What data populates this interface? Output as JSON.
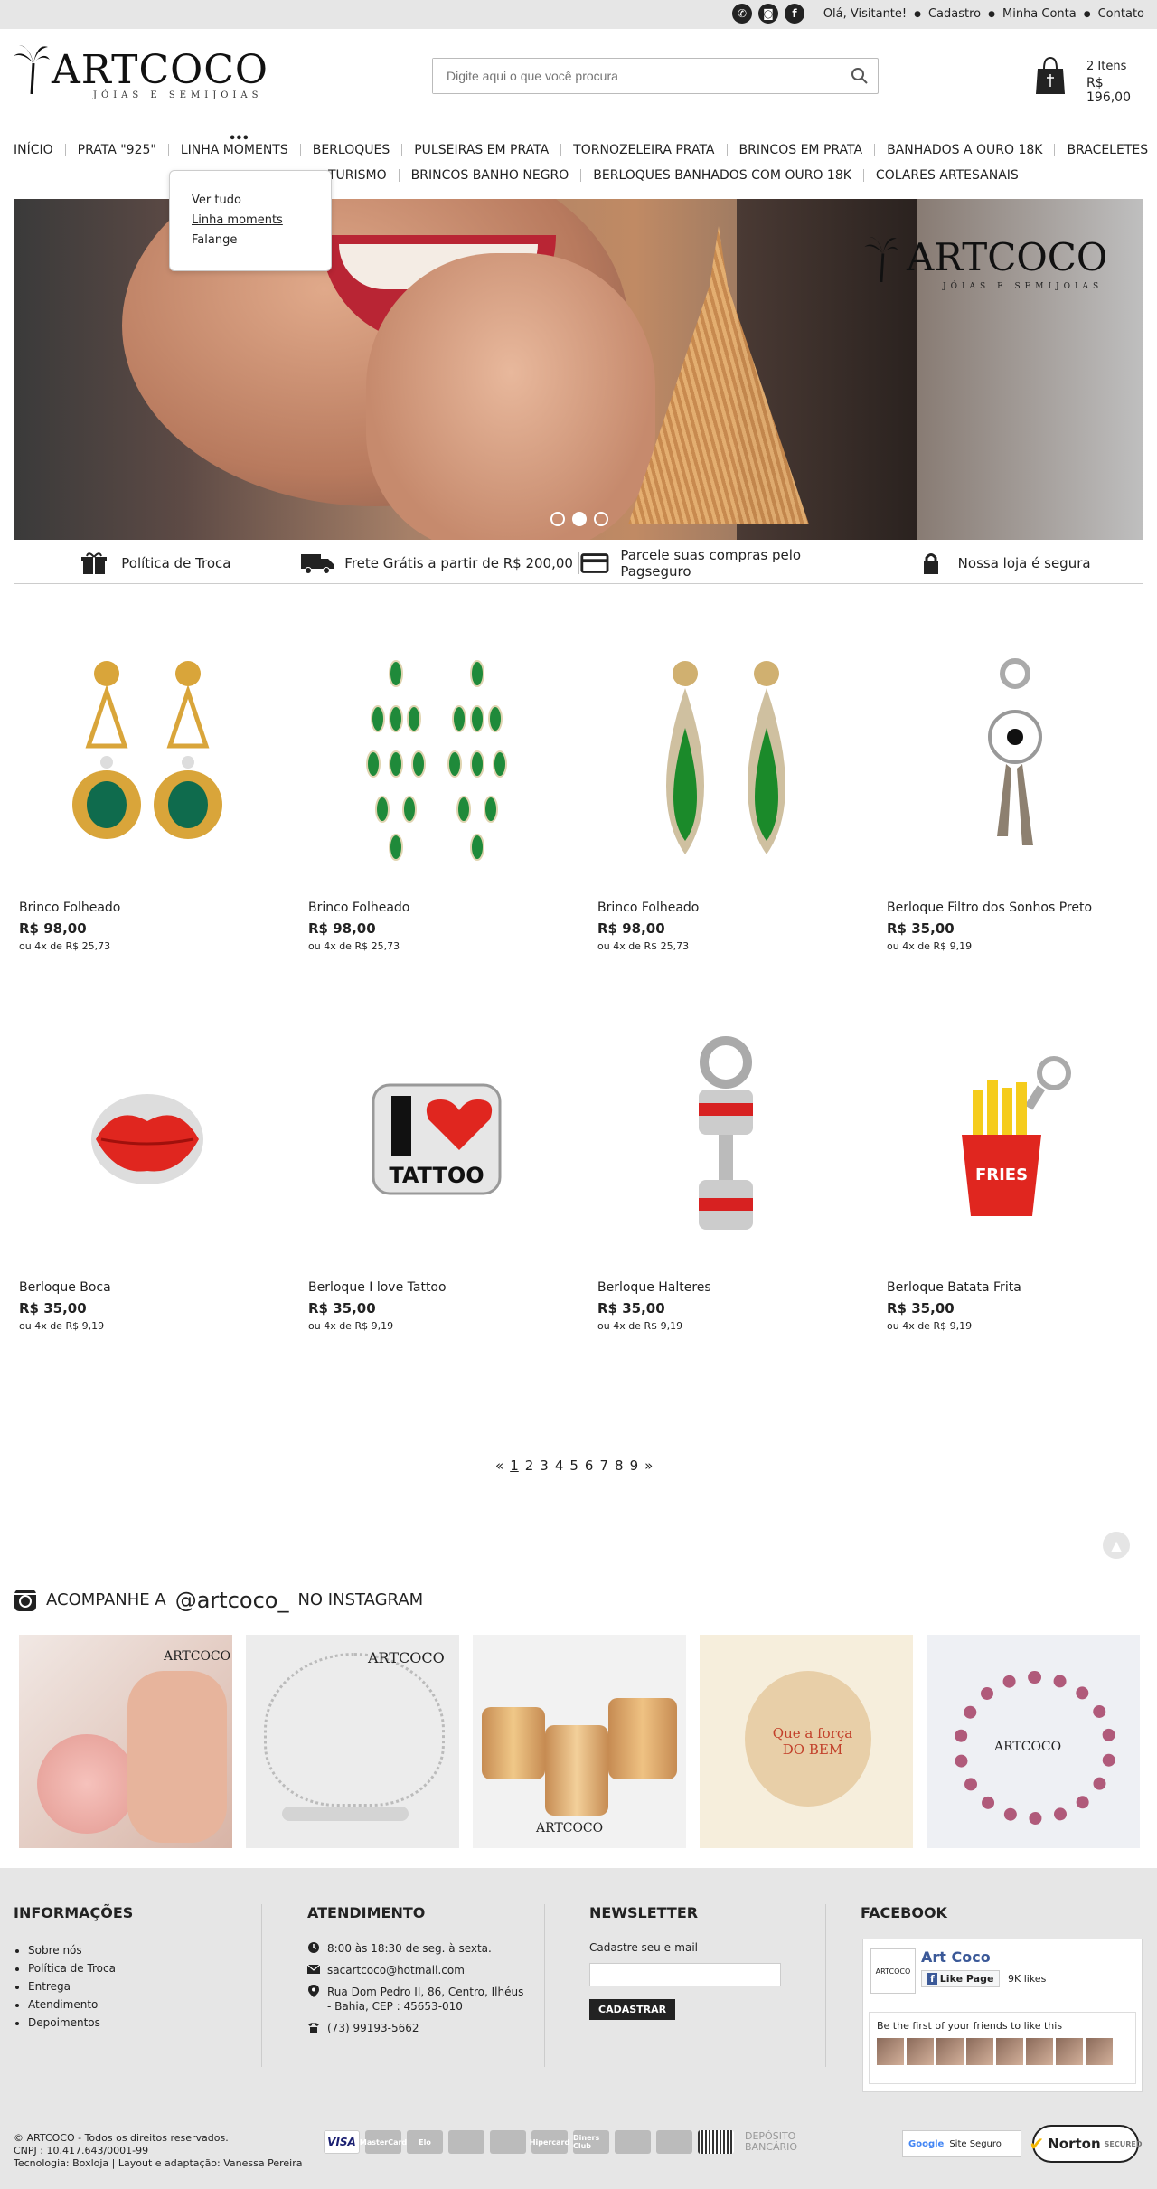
{
  "topbar": {
    "social_icons": [
      "whatsapp-icon",
      "instagram-icon",
      "facebook-icon"
    ],
    "links": [
      "Olá, Visitante!",
      "Cadastro",
      "Minha Conta",
      "Contato"
    ]
  },
  "logo": {
    "brand": "ARTCOCO",
    "tagline": "JÓIAS E SEMIJOIAS"
  },
  "search": {
    "placeholder": "Digite aqui o que você procura"
  },
  "cart": {
    "items": "2 Itens",
    "total": "R$ 196,00"
  },
  "nav": {
    "row1": [
      "INÍCIO",
      "PRATA \"925\"",
      "LINHA MOMENTS",
      "BERLOQUES",
      "PULSEIRAS EM PRATA",
      "TORNOZELEIRA PRATA",
      "BRINCOS EM PRATA",
      "BANHADOS A OURO 18K",
      "BRACELETES"
    ],
    "row2": [
      "TURISMO",
      "BRINCOS BANHO NEGRO",
      "BERLOQUES BANHADOS COM OURO 18K",
      "COLARES ARTESANAIS"
    ],
    "dropdown": [
      "Ver tudo",
      "Linha moments",
      "Falange"
    ]
  },
  "banner": {
    "brand": "ARTCOCO",
    "tagline": "JÓIAS E SEMIJOIAS",
    "slides": 3,
    "active_slide": 2
  },
  "benefits": [
    "Política de Troca",
    "Frete Grátis a partir de R$ 200,00",
    "Parcele suas compras pelo Pagseguro",
    "Nossa loja é segura"
  ],
  "products": [
    {
      "name": "Brinco Folheado",
      "price": "R$ 98,00",
      "installment": "ou 4x de R$ 25,73"
    },
    {
      "name": "Brinco Folheado",
      "price": "R$ 98,00",
      "installment": "ou 4x de R$ 25,73"
    },
    {
      "name": "Brinco Folheado",
      "price": "R$ 98,00",
      "installment": "ou 4x de R$ 25,73"
    },
    {
      "name": "Berloque Filtro dos Sonhos Preto",
      "price": "R$ 35,00",
      "installment": "ou 4x de R$ 9,19"
    },
    {
      "name": "Berloque Boca",
      "price": "R$ 35,00",
      "installment": "ou 4x de R$ 9,19"
    },
    {
      "name": "Berloque I love Tattoo",
      "price": "R$ 35,00",
      "installment": "ou 4x de R$ 9,19"
    },
    {
      "name": "Berloque Halteres",
      "price": "R$ 35,00",
      "installment": "ou 4x de R$ 9,19"
    },
    {
      "name": "Berloque Batata Frita",
      "price": "R$ 35,00",
      "installment": "ou 4x de R$ 9,19"
    }
  ],
  "pagination": {
    "prev": "«",
    "pages": [
      "1",
      "2",
      "3",
      "4",
      "5",
      "6",
      "7",
      "8",
      "9"
    ],
    "current": "1",
    "next": "»"
  },
  "instagram": {
    "prefix": "ACOMPANHE A",
    "handle": "@artcoco_",
    "suffix": "NO INSTAGRAM",
    "photo_brand": "ARTCOCO",
    "owl_text": "Que a força DO BEM"
  },
  "footer": {
    "info_title": "INFORMAÇÕES",
    "info_links": [
      "Sobre nós",
      "Política de Troca",
      "Entrega",
      "Atendimento",
      "Depoimentos"
    ],
    "atend_title": "ATENDIMENTO",
    "hours": "8:00 às 18:30 de seg. à sexta.",
    "email": "sacartcoco@hotmail.com",
    "address": "Rua Dom Pedro II, 86, Centro, Ilhéus - Bahia, CEP : 45653-010",
    "phone": "(73) 99193-5662",
    "newsletter_title": "NEWSLETTER",
    "newsletter_label": "Cadastre seu e-mail",
    "newsletter_button": "CADASTRAR",
    "facebook_title": "FACEBOOK",
    "fb_page": "Art Coco",
    "fb_like": "Like Page",
    "fb_likes": "9K likes",
    "fb_friends": "Be the first of your friends to like this",
    "copyright": "© ARTCOCO - Todos os direitos reservados.",
    "cnpj": "CNPJ : 10.417.643/0001-99",
    "tech": "Tecnologia: Boxloja | Layout e adaptação: Vanessa Pereira",
    "payments": [
      "VISA",
      "MasterCard",
      "Elo",
      "",
      "",
      "Hipercard",
      "Diners Club",
      "",
      "",
      ""
    ],
    "deposit": "DEPÓSITO BANCÁRIO",
    "site_seguro": "Site Seguro",
    "norton": "Norton",
    "norton_sub": "SECURED"
  },
  "colors": {
    "topbar": "#e6e6e6",
    "footer": "#e6e6e6",
    "fb_blue": "#3b5998",
    "text": "#222222"
  }
}
